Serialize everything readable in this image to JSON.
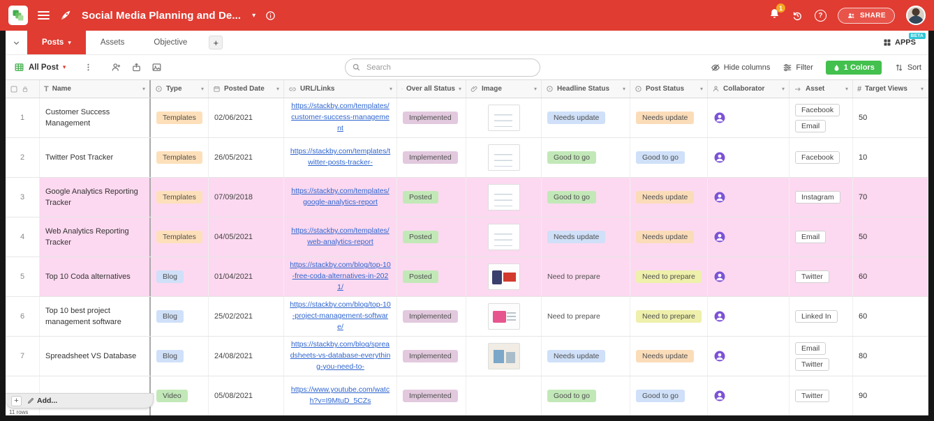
{
  "topbar": {
    "title": "Social Media Planning and De...",
    "share_label": "SHARE",
    "notification_count": "1"
  },
  "tabs": {
    "items": [
      {
        "label": "Posts"
      },
      {
        "label": "Assets"
      },
      {
        "label": "Objective"
      }
    ],
    "apps_label": "APPS",
    "beta_label": "BETA"
  },
  "toolbar": {
    "view_name": "All Post",
    "search_placeholder": "Search",
    "hide_columns_label": "Hide columns",
    "filter_label": "Filter",
    "colors_label": "1 Colors",
    "sort_label": "Sort"
  },
  "icons": {
    "caret_down": "▾",
    "plus": "+",
    "hash": "#",
    "letter_t": "T",
    "question": "?"
  },
  "colors": {
    "brand_red": "#e03c32",
    "highlight_pink": "#fcd9f0",
    "colors_button_green": "#43c04e"
  },
  "table": {
    "columns": [
      {
        "label": "Name"
      },
      {
        "label": "Type"
      },
      {
        "label": "Posted Date"
      },
      {
        "label": "URL/Links"
      },
      {
        "label": "Over all Status"
      },
      {
        "label": "Image"
      },
      {
        "label": "Headline Status"
      },
      {
        "label": "Post Status"
      },
      {
        "label": "Collaborator"
      },
      {
        "label": "Asset"
      },
      {
        "label": "Target Views"
      }
    ],
    "rows": [
      {
        "num": "1",
        "name": "Customer Success Management",
        "type": "Templates",
        "type_color": "orange",
        "date": "02/06/2021",
        "url": "https://stackby.com/templates/customer-success-management",
        "overall": "Implemented",
        "overall_color": "mauve",
        "thumb": "doc",
        "headline": "Needs update",
        "headline_color": "blue",
        "post": "Needs update",
        "post_color": "peach",
        "asset1": "Facebook",
        "asset2": "Email",
        "views": "50",
        "highlight": "false"
      },
      {
        "num": "2",
        "name": "Twitter Post Tracker",
        "type": "Templates",
        "type_color": "orange",
        "date": "26/05/2021",
        "url": "https://stackby.com/templates/twitter-posts-tracker-",
        "overall": "Implemented",
        "overall_color": "mauve",
        "thumb": "doc",
        "headline": "Good to go",
        "headline_color": "green",
        "post": "Good to go",
        "post_color": "blue",
        "asset1": "Facebook",
        "asset2": "",
        "views": "10",
        "highlight": "false"
      },
      {
        "num": "3",
        "name": "Google Analytics Reporting Tracker",
        "type": "Templates",
        "type_color": "orange",
        "date": "07/09/2018",
        "url": "https://stackby.com/templates/google-analytics-report",
        "overall": "Posted",
        "overall_color": "green",
        "thumb": "doc",
        "headline": "Good to go",
        "headline_color": "green",
        "post": "Needs update",
        "post_color": "peach",
        "asset1": "Instagram",
        "asset2": "",
        "views": "70",
        "highlight": "true"
      },
      {
        "num": "4",
        "name": "Web Analytics Reporting Tracker",
        "type": "Templates",
        "type_color": "orange",
        "date": "04/05/2021",
        "url": "https://stackby.com/templates/web-analytics-report",
        "overall": "Posted",
        "overall_color": "green",
        "thumb": "doc",
        "headline": "Needs update",
        "headline_color": "blue",
        "post": "Needs update",
        "post_color": "peach",
        "asset1": "Email",
        "asset2": "",
        "views": "50",
        "highlight": "true"
      },
      {
        "num": "5",
        "name": "Top 10 Coda alternatives",
        "type": "Blog",
        "type_color": "blue",
        "date": "01/04/2021",
        "url": "https://stackby.com/blog/top-10-free-coda-alternatives-in-2021/",
        "overall": "Posted",
        "overall_color": "green",
        "thumb": "coda",
        "headline": "Need to prepare",
        "headline_color": "none",
        "post": "Need to prepare",
        "post_color": "yellow",
        "asset1": "Twitter",
        "asset2": "",
        "views": "60",
        "highlight": "true"
      },
      {
        "num": "6",
        "name": "Top 10 best project management software",
        "type": "Blog",
        "type_color": "blue",
        "date": "25/02/2021",
        "url": "https://stackby.com/blog/top-10-project-management-software/",
        "overall": "Implemented",
        "overall_color": "mauve",
        "thumb": "pm",
        "headline": "Need to prepare",
        "headline_color": "none",
        "post": "Need to prepare",
        "post_color": "yellow",
        "asset1": "Linked In",
        "asset2": "",
        "views": "60",
        "highlight": "false"
      },
      {
        "num": "7",
        "name": "Spreadsheet VS Database",
        "type": "Blog",
        "type_color": "blue",
        "date": "24/08/2021",
        "url": "https://stackby.com/blog/spreadsheets-vs-database-everything-you-need-to-",
        "overall": "Implemented",
        "overall_color": "mauve",
        "thumb": "spread",
        "headline": "Needs update",
        "headline_color": "blue",
        "post": "Needs update",
        "post_color": "peach",
        "asset1": "Email",
        "asset2": "Twitter",
        "views": "80",
        "highlight": "false"
      },
      {
        "num": "",
        "name": "",
        "type": "Video",
        "type_color": "green",
        "date": "05/08/2021",
        "url": "https://www.youtube.com/watch?v=I9MtuD_5CZs",
        "overall": "Implemented",
        "overall_color": "mauve",
        "thumb": "none",
        "headline": "Good to go",
        "headline_color": "green",
        "post": "Good to go",
        "post_color": "blue",
        "asset1": "Twitter",
        "asset2": "",
        "views": "90",
        "highlight": "false"
      }
    ],
    "add_label": "Add...",
    "row_count_label": "11 rows"
  }
}
